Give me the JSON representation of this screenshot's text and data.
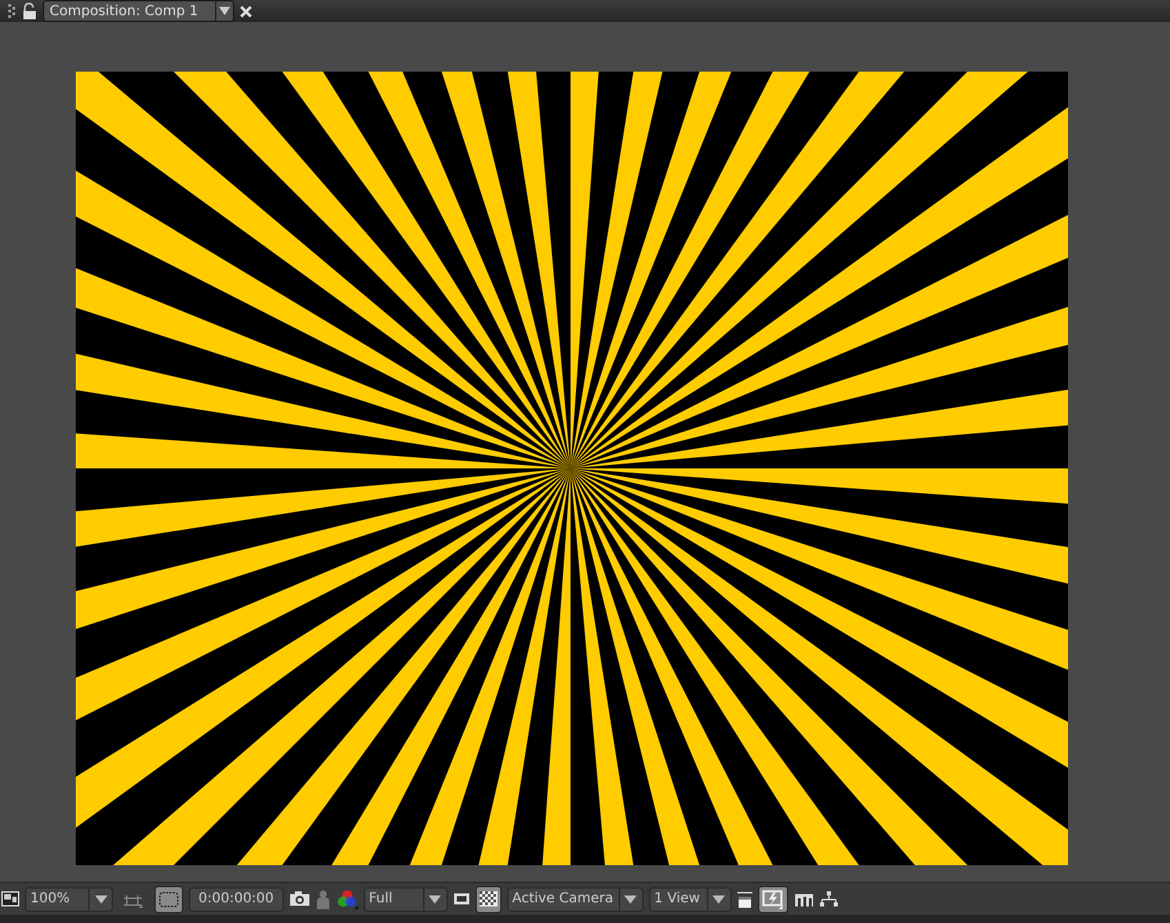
{
  "panel_tab": {
    "title": "Composition: Comp 1",
    "selected": true
  },
  "toolbar": {
    "zoom": "100%",
    "grid_toggle": {
      "on": false
    },
    "region_toggle": {
      "on": true
    },
    "timecode": "0:00:00:00",
    "resolution": "Full",
    "transparency_toggle": {
      "on": true
    },
    "camera": "Active Camera",
    "views": "1 View",
    "fast_preview_toggle": {
      "on": true
    }
  }
}
